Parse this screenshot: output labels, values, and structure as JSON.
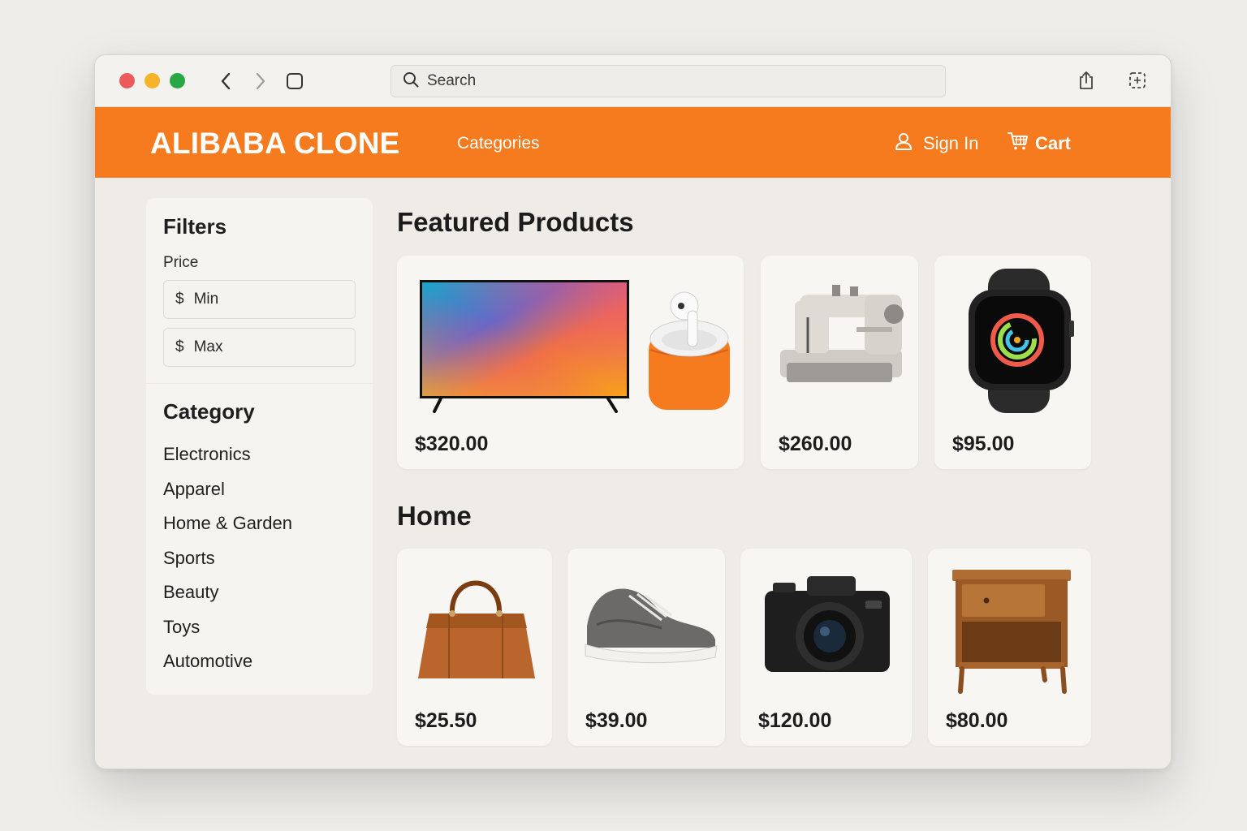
{
  "browser": {
    "search_placeholder": "Search",
    "icons": [
      "back-icon",
      "forward-icon",
      "sidebar-icon",
      "search-icon",
      "share-icon",
      "tabs-icon"
    ]
  },
  "header": {
    "brand": "ALIBABA CLONE",
    "nav_categories": "Categories",
    "sign_in": "Sign In",
    "cart": "Cart",
    "accent_color": "#f57b1e"
  },
  "filters": {
    "title": "Filters",
    "price_label": "Price",
    "currency": "$",
    "min_placeholder": "Min",
    "max_placeholder": "Max",
    "category_title": "Category",
    "categories": [
      "Electronics",
      "Apparel",
      "Home & Garden",
      "Sports",
      "Beauty",
      "Toys",
      "Automotive"
    ]
  },
  "featured": {
    "title": "Featured Products",
    "products": [
      {
        "image": "tv-and-earbuds",
        "price": "$320.00"
      },
      {
        "image": "sewing-machine",
        "price": "$260.00"
      },
      {
        "image": "smartwatch",
        "price": "$95.00"
      }
    ]
  },
  "home": {
    "title": "Home",
    "products": [
      {
        "image": "handbag",
        "price": "$25.50"
      },
      {
        "image": "sneaker",
        "price": "$39.00"
      },
      {
        "image": "camera",
        "price": "$120.00"
      },
      {
        "image": "nightstand",
        "price": "$80.00"
      }
    ]
  }
}
